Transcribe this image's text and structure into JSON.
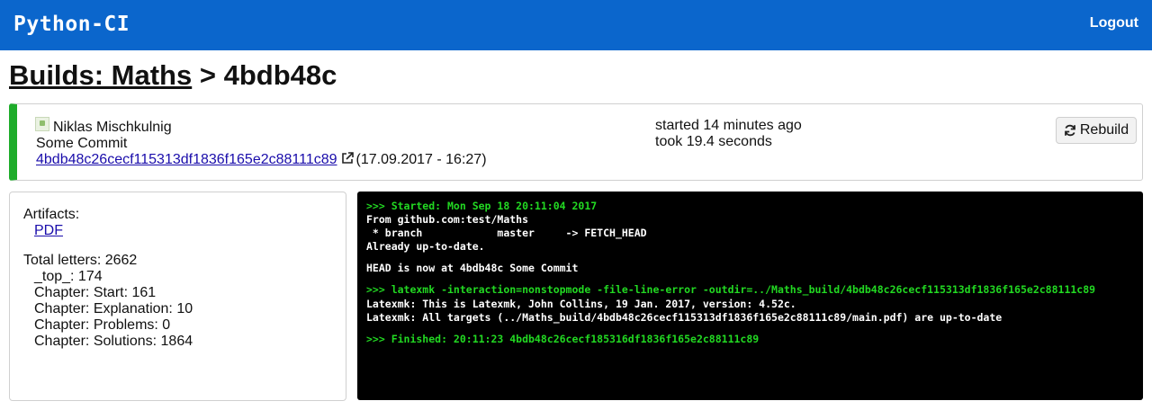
{
  "navbar": {
    "brand": "Python-CI",
    "logout": "Logout",
    "background": "#0b66cc"
  },
  "title": {
    "builds_link": "Builds: Maths",
    "separator": " > ",
    "commit_short": "4bdb48c"
  },
  "commit": {
    "author": "Niklas Mischkulnig",
    "message": "Some Commit",
    "hash": "4bdb48c26cecf115313df1836f165e2c88111c89",
    "date": "(17.09.2017 - 16:27)",
    "started": "started 14 minutes ago",
    "took": "took 19.4 seconds",
    "status_color": "#1eac2a",
    "rebuild_label": "Rebuild",
    "icons": [
      "avatar-image",
      "external-link-icon",
      "refresh-icon"
    ]
  },
  "stats": {
    "artifacts_label": "Artifacts:",
    "artifacts": [
      "PDF"
    ],
    "total_letters": "Total letters: 2662",
    "entries": [
      "_top_: 174",
      "Chapter: Start: 161",
      "Chapter: Explanation: 10",
      "Chapter: Problems: 0",
      "Chapter: Solutions: 1864"
    ]
  },
  "console": {
    "lines": [
      ">>> Started: Mon Sep 18 20:11:04 2017",
      "From github.com:test/Maths",
      " * branch            master     -> FETCH_HEAD",
      "Already up-to-date.",
      "HEAD is now at 4bdb48c Some Commit",
      ">>> latexmk -interaction=nonstopmode -file-line-error -outdir=../Maths_build/4bdb48c26cecf115313df1836f165e2c88111c89",
      "Latexmk: This is Latexmk, John Collins, 19 Jan. 2017, version: 4.52c.",
      "Latexmk: All targets (../Maths_build/4bdb48c26cecf115313df1836f165e2c88111c89/main.pdf) are up-to-date",
      ">>> Finished: 20:11:23 4bdb48c26cecf185316df1836f165e2c88111c89"
    ],
    "green_color": "#22d922"
  }
}
